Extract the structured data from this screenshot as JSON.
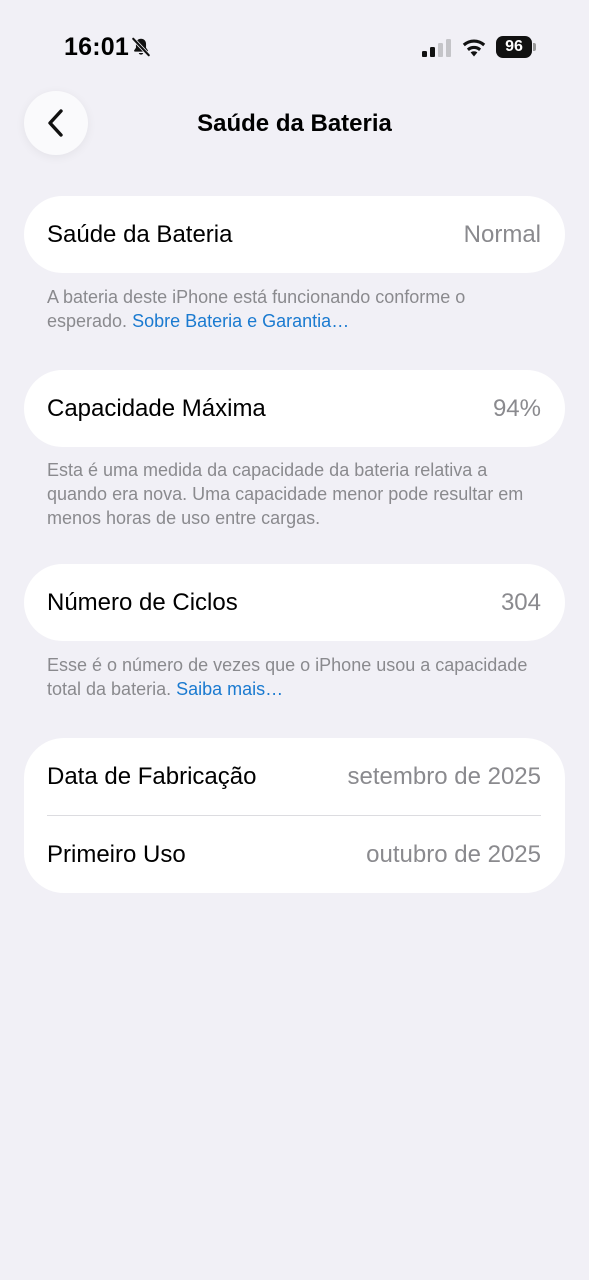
{
  "status_bar": {
    "time": "16:01",
    "battery_level": "96",
    "icons": [
      "bell-slash-icon",
      "cellular-signal-icon",
      "wifi-icon",
      "battery-icon"
    ]
  },
  "nav": {
    "title": "Saúde da Bateria",
    "back_icon": "chevron-left-icon"
  },
  "sections": {
    "health": {
      "label": "Saúde da Bateria",
      "value": "Normal",
      "footnote": "A bateria deste iPhone está funcionando conforme o esperado.",
      "link": "Sobre Bateria e Garantia…"
    },
    "capacity": {
      "label": "Capacidade Máxima",
      "value": "94%",
      "footnote": "Esta é uma medida da capacidade da bateria relativa a quando era nova. Uma capacidade menor pode resultar em menos horas de uso entre cargas."
    },
    "cycles": {
      "label": "Número de Ciclos",
      "value": "304",
      "footnote": "Esse é o número de vezes que o iPhone usou a capacidade total da bateria.",
      "link": "Saiba mais…"
    },
    "dates": {
      "manufacture_label": "Data de Fabricação",
      "manufacture_value": "setembro de 2025",
      "first_use_label": "Primeiro Uso",
      "first_use_value": "outubro de 2025"
    }
  },
  "colors": {
    "background": "#f1f0f6",
    "card": "#ffffff",
    "secondary_text": "#8a8a8e",
    "link": "#1a7ad0"
  }
}
